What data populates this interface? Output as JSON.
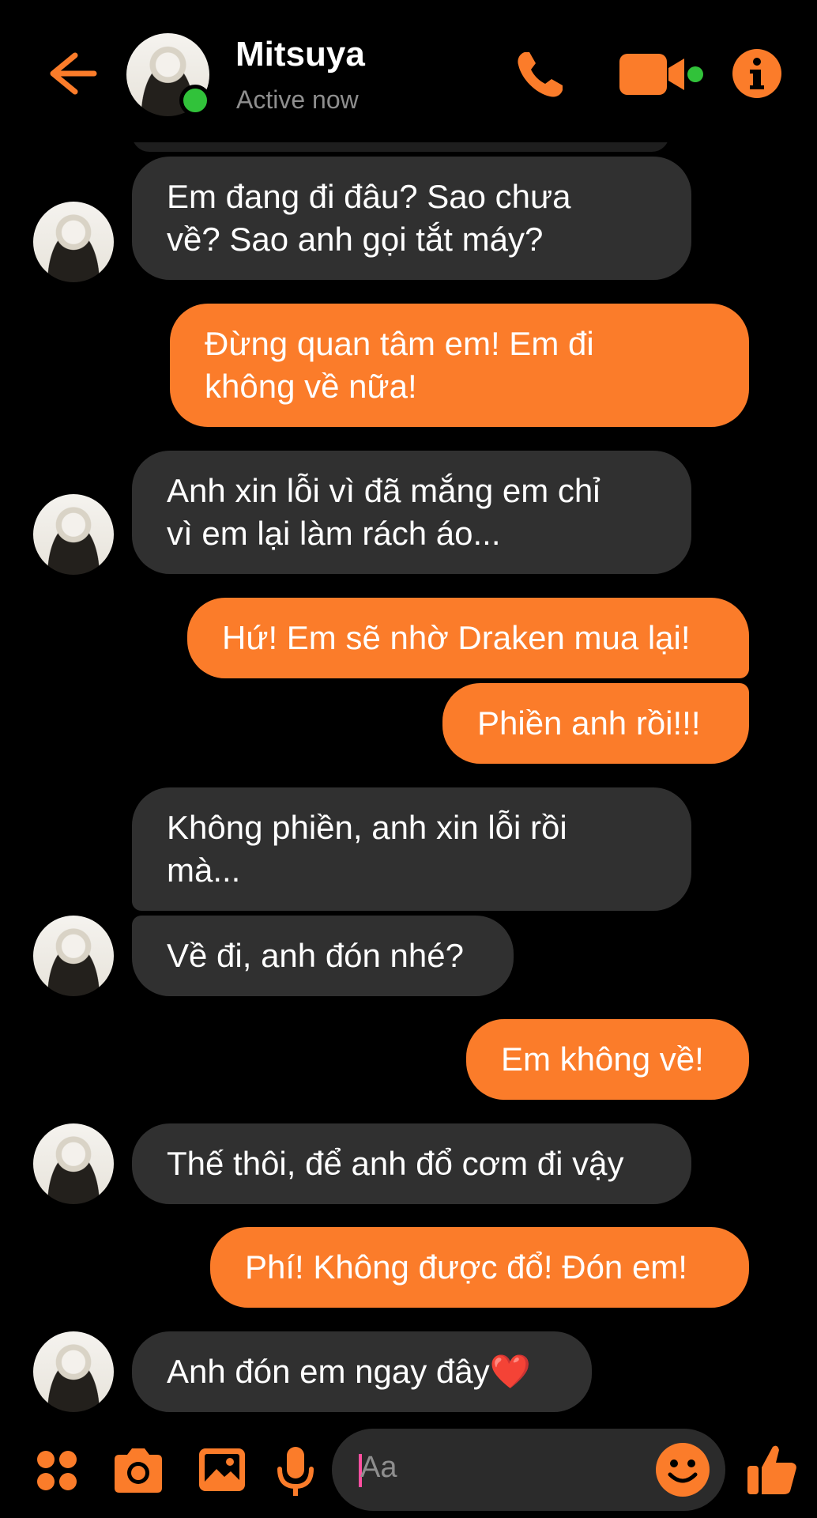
{
  "header": {
    "title": "Mitsuya",
    "status": "Active now"
  },
  "messages": [
    {
      "sender": "contact",
      "text": "Em đang đi đâu? Sao chưa\nvề? Sao anh gọi tắt máy?"
    },
    {
      "sender": "me",
      "text": "Đừng quan tâm em! Em đi\nkhông về nữa!"
    },
    {
      "sender": "contact",
      "text": "Anh xin lỗi vì đã mắng em chỉ\nvì em lại làm rách áo..."
    },
    {
      "sender": "me",
      "text": "Hứ! Em sẽ nhờ Draken mua lại!"
    },
    {
      "sender": "me",
      "text": "Phiền anh rồi!!!"
    },
    {
      "sender": "contact",
      "text": "Không phiền, anh xin lỗi rồi\nmà..."
    },
    {
      "sender": "contact",
      "text": "Về đi, anh đón nhé?"
    },
    {
      "sender": "me",
      "text": "Em không về!"
    },
    {
      "sender": "contact",
      "text": "Thế thôi, để anh đổ cơm đi vậy"
    },
    {
      "sender": "me",
      "text": "Phí! Không được đổ! Đón em!"
    },
    {
      "sender": "contact",
      "text": "Anh đón em ngay đây❤️"
    }
  ],
  "composer": {
    "placeholder": "Aa"
  },
  "icons": {
    "back": "back-arrow-icon",
    "call": "phone-icon",
    "video": "video-camera-icon",
    "info": "info-icon",
    "apps": "apps-icon",
    "camera": "camera-icon",
    "gallery": "gallery-icon",
    "mic": "microphone-icon",
    "emoji": "emoji-icon",
    "like": "thumbs-up-icon"
  },
  "colors": {
    "accent": "#fb7c2a",
    "incoming_bubble": "#303030",
    "online": "#31c23a",
    "background": "#000000"
  }
}
